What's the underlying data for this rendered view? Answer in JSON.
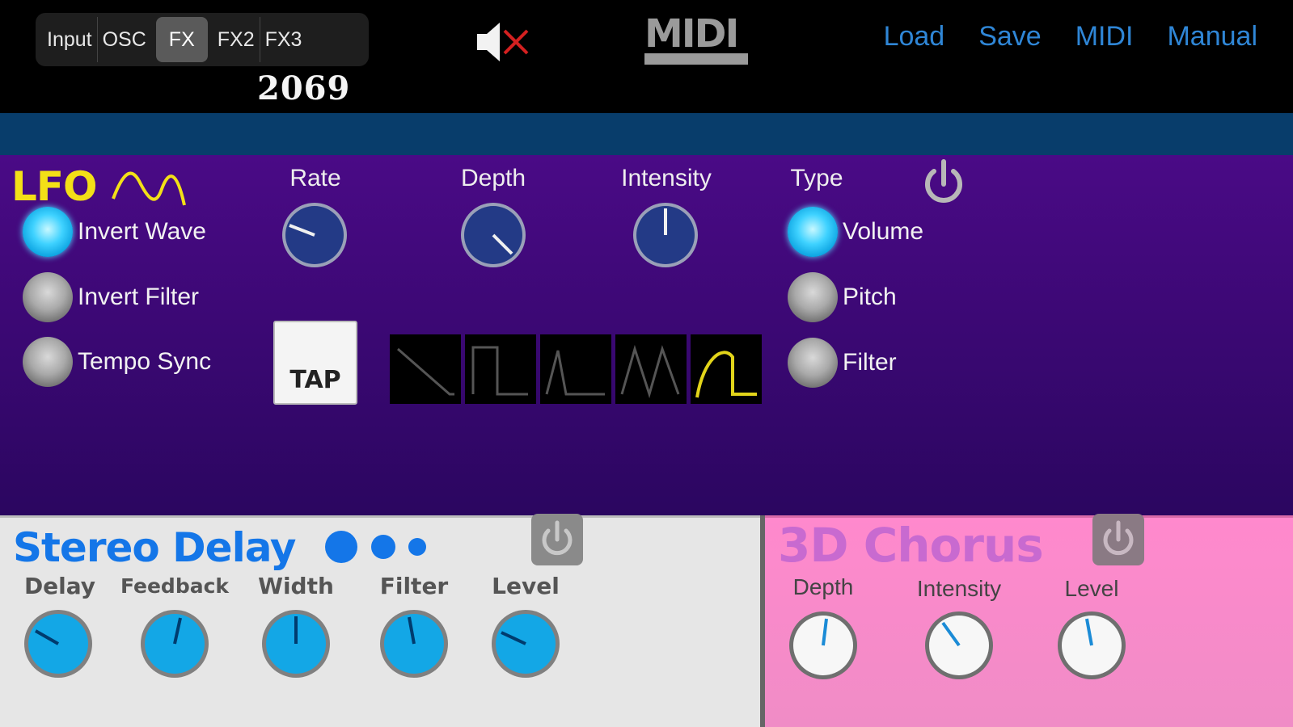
{
  "app": {
    "brand_year": "2069"
  },
  "tabs": [
    {
      "label": "Input"
    },
    {
      "label": "OSC"
    },
    {
      "label": "FX"
    },
    {
      "label": "FX2"
    },
    {
      "label": "FX3"
    }
  ],
  "top_links": {
    "load": "Load",
    "save": "Save",
    "midi": "MIDI",
    "manual": "Manual"
  },
  "midi_logo_text": "MIDI",
  "lfo": {
    "title": "LFO",
    "toggles": [
      {
        "label": "Invert Wave",
        "state": "on"
      },
      {
        "label": "Invert Filter",
        "state": "off"
      },
      {
        "label": "Tempo Sync",
        "state": "off"
      }
    ],
    "knobs": [
      {
        "label": "Rate"
      },
      {
        "label": "Depth"
      },
      {
        "label": "Intensity"
      }
    ],
    "tap_label": "TAP",
    "waveform_selected": "hump",
    "type_label": "Type",
    "types": [
      {
        "label": "Volume",
        "state": "on"
      },
      {
        "label": "Pitch",
        "state": "off"
      },
      {
        "label": "Filter",
        "state": "off"
      }
    ]
  },
  "stereo_delay": {
    "title": "Stereo Delay",
    "params": [
      {
        "label": "Delay"
      },
      {
        "label": "Feedback"
      },
      {
        "label": "Width"
      },
      {
        "label": "Filter"
      },
      {
        "label": "Level"
      }
    ]
  },
  "chorus": {
    "title": "3D Chorus",
    "params": [
      {
        "label": "Depth"
      },
      {
        "label": "Intensity"
      },
      {
        "label": "Level"
      }
    ]
  },
  "colors": {
    "link_blue": "#2f86d6",
    "lfo_yellow": "#f3e017",
    "delay_blue": "#1476e8",
    "chorus_pink": "#ff89cd"
  }
}
